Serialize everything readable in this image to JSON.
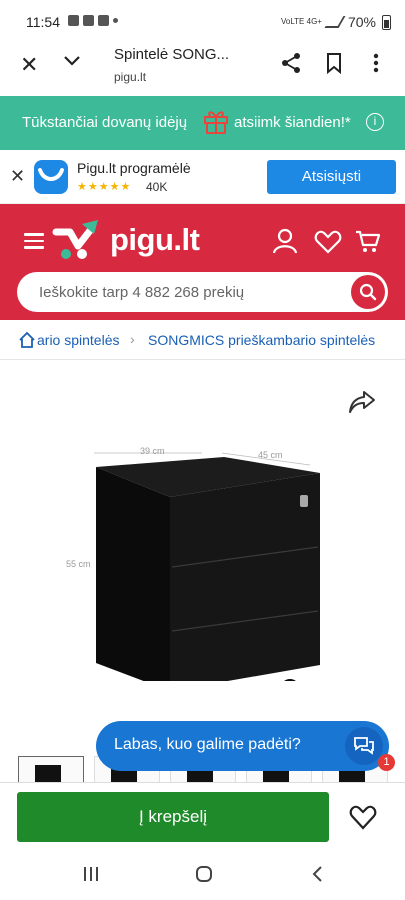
{
  "status_bar": {
    "time": "11:54",
    "network_label": "VoLTE 4G+",
    "battery": "70%"
  },
  "browser": {
    "page_title": "Spintelė SONG...",
    "url": "pigu.lt",
    "icons": [
      "close-icon",
      "chevron-down-icon",
      "share-icon",
      "bookmark-icon",
      "more-vert-icon"
    ]
  },
  "promo": {
    "text_before": "Tūkstančiai dovanų idėjų",
    "text_after": "atsiimk šiandien!*",
    "info": "i",
    "bg_color": "#3dbb98"
  },
  "app_banner": {
    "name": "Pigu.lt programėlė",
    "stars": "★★★★★",
    "rating_count": "40K",
    "download_label": "Atsisiųsti",
    "accent": "#1e88e5"
  },
  "header": {
    "logo_text": "pigu.lt",
    "brand_color": "#d7293f",
    "search_placeholder": "Ieškokite tarp 4 882 268 prekių"
  },
  "breadcrumb": {
    "items": [
      "ario spintelės",
      "SONGMICS prieškambario spintelės"
    ],
    "separator": "›"
  },
  "product": {
    "dimension_labels": {
      "width": "39 cm",
      "depth": "45 cm",
      "height": "55 cm"
    }
  },
  "chat": {
    "text": "Labas, kuo galime padėti?",
    "badge": "1"
  },
  "actions": {
    "add_to_cart": "Į krepšelį",
    "cta_color": "#1f8a2a"
  }
}
